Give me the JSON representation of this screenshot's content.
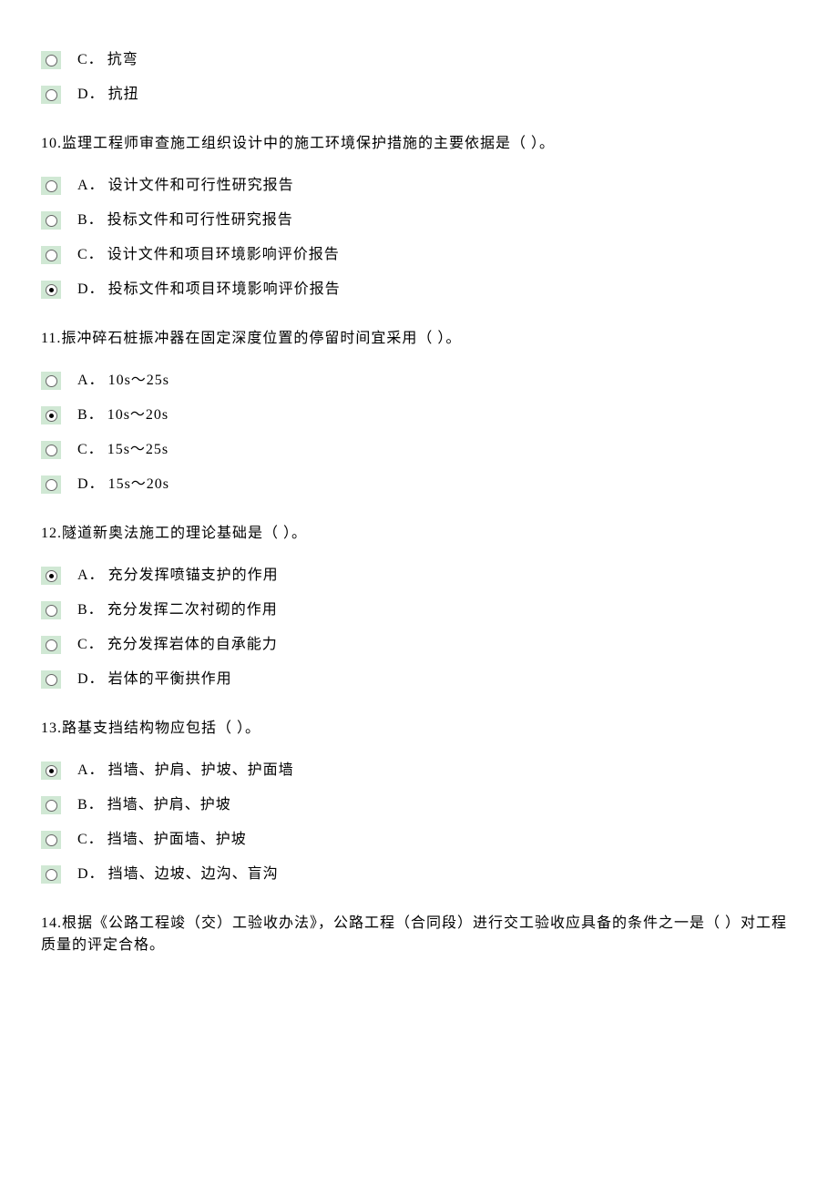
{
  "q9_tail": {
    "options": [
      {
        "label": "C．",
        "text": "抗弯",
        "selected": false
      },
      {
        "label": "D．",
        "text": "抗扭",
        "selected": false
      }
    ]
  },
  "q10": {
    "text": "10.监理工程师审查施工组织设计中的施工环境保护措施的主要依据是（  ）。",
    "options": [
      {
        "label": "A．",
        "text": "设计文件和可行性研究报告",
        "selected": false
      },
      {
        "label": "B．",
        "text": "投标文件和可行性研究报告",
        "selected": false
      },
      {
        "label": "C．",
        "text": "设计文件和项目环境影响评价报告",
        "selected": false
      },
      {
        "label": "D．",
        "text": "投标文件和项目环境影响评价报告",
        "selected": true
      }
    ]
  },
  "q11": {
    "text": "11.振冲碎石桩振冲器在固定深度位置的停留时间宜采用（  ）。",
    "options": [
      {
        "label": "A．",
        "text": "10s～25s",
        "selected": false
      },
      {
        "label": "B．",
        "text": "10s～20s",
        "selected": true
      },
      {
        "label": "C．",
        "text": "15s～25s",
        "selected": false
      },
      {
        "label": "D．",
        "text": "15s～20s",
        "selected": false
      }
    ]
  },
  "q12": {
    "text": "12.隧道新奥法施工的理论基础是（  ）。",
    "options": [
      {
        "label": "A．",
        "text": "充分发挥喷锚支护的作用",
        "selected": true
      },
      {
        "label": "B．",
        "text": "充分发挥二次衬砌的作用",
        "selected": false
      },
      {
        "label": "C．",
        "text": "充分发挥岩体的自承能力",
        "selected": false
      },
      {
        "label": "D．",
        "text": "岩体的平衡拱作用",
        "selected": false
      }
    ]
  },
  "q13": {
    "text": "13.路基支挡结构物应包括（  ）。",
    "options": [
      {
        "label": "A．",
        "text": "挡墙、护肩、护坡、护面墙",
        "selected": true
      },
      {
        "label": "B．",
        "text": "挡墙、护肩、护坡",
        "selected": false
      },
      {
        "label": "C．",
        "text": "挡墙、护面墙、护坡",
        "selected": false
      },
      {
        "label": "D．",
        "text": "挡墙、边坡、边沟、盲沟",
        "selected": false
      }
    ]
  },
  "q14": {
    "text": "14.根据《公路工程竣（交）工验收办法》，公路工程（合同段）进行交工验收应具备的条件之一是（  ）对工程质量的评定合格。"
  }
}
